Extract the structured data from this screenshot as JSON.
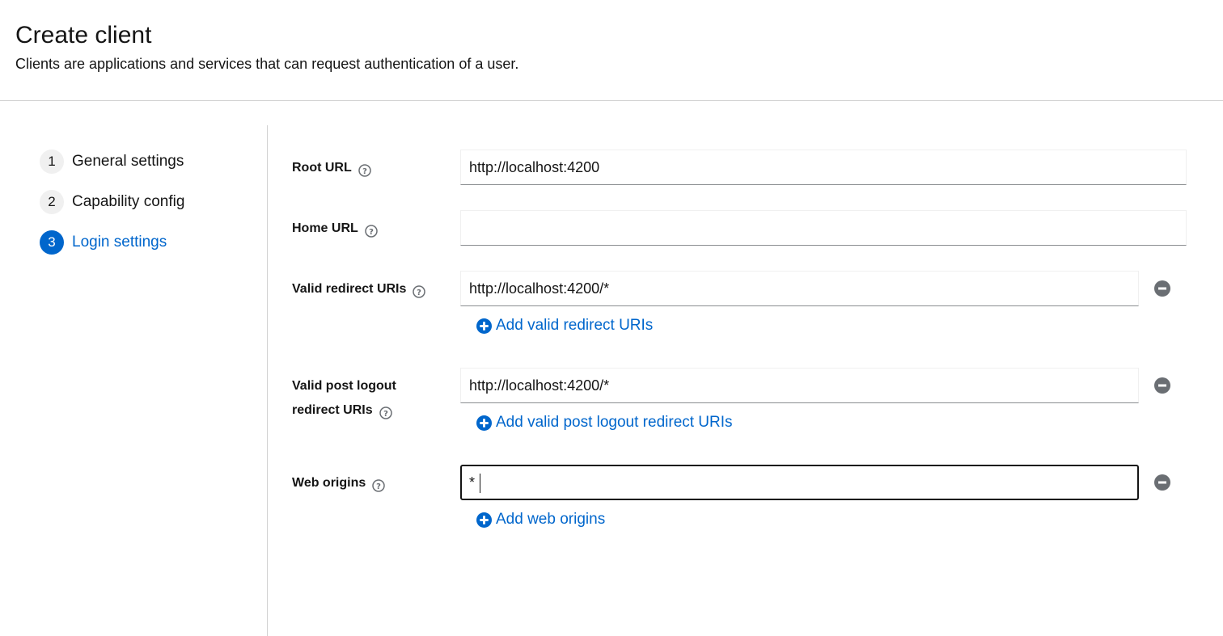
{
  "header": {
    "title": "Create client",
    "subtitle": "Clients are applications and services that can request authentication of a user."
  },
  "wizard": {
    "steps": [
      {
        "number": "1",
        "label": "General settings"
      },
      {
        "number": "2",
        "label": "Capability config"
      },
      {
        "number": "3",
        "label": "Login settings"
      }
    ],
    "current_step": "3"
  },
  "form": {
    "root_url": {
      "label": "Root URL",
      "value": "http://localhost:4200"
    },
    "home_url": {
      "label": "Home URL",
      "value": ""
    },
    "valid_redirect_uris": {
      "label": "Valid redirect URIs",
      "values": [
        "http://localhost:4200/*"
      ],
      "add_label": "Add valid redirect URIs"
    },
    "valid_post_logout_redirect_uris": {
      "label_line1": "Valid post logout",
      "label_line2": "redirect URIs",
      "values": [
        "http://localhost:4200/*"
      ],
      "add_label": "Add valid post logout redirect URIs"
    },
    "web_origins": {
      "label": "Web origins",
      "values": [
        "*"
      ],
      "add_label": "Add web origins"
    }
  },
  "colors": {
    "accent": "#0066cc",
    "text": "#151515",
    "divider": "#d2d2d2",
    "remove_icon": "#6a6e73"
  },
  "icons": {
    "help": "question-circle-icon",
    "remove": "minus-circle-icon",
    "add": "plus-circle-icon"
  }
}
